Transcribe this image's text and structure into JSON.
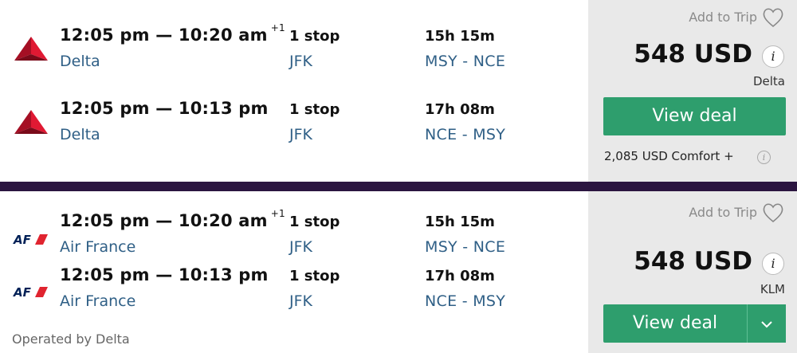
{
  "results": [
    {
      "legs": [
        {
          "airline": "Delta",
          "logo": "delta-logo",
          "departure": "12:05 pm",
          "arrival": "10:20 am",
          "day_offset": "+1",
          "stops": "1 stop",
          "via": "JFK",
          "duration": "15h 15m",
          "route": "MSY - NCE"
        },
        {
          "airline": "Delta",
          "logo": "delta-logo",
          "departure": "12:05 pm",
          "arrival": "10:13 pm",
          "day_offset": "",
          "stops": "1 stop",
          "via": "JFK",
          "duration": "17h 08m",
          "route": "NCE - MSY"
        }
      ],
      "add_to_trip": "Add to Trip",
      "price": "548 USD",
      "provider": "Delta",
      "view_deal": "View deal",
      "comfort_price": "2,085 USD Comfort +"
    },
    {
      "legs": [
        {
          "airline": "Air France",
          "logo": "air-france-logo",
          "departure": "12:05 pm",
          "arrival": "10:20 am",
          "day_offset": "+1",
          "stops": "1 stop",
          "via": "JFK",
          "duration": "15h 15m",
          "route": "MSY - NCE"
        },
        {
          "airline": "Air France",
          "logo": "air-france-logo",
          "departure": "12:05 pm",
          "arrival": "10:13 pm",
          "day_offset": "",
          "stops": "1 stop",
          "via": "JFK",
          "duration": "17h 08m",
          "route": "NCE - MSY"
        }
      ],
      "add_to_trip": "Add to Trip",
      "price": "548 USD",
      "provider": "KLM",
      "view_deal": "View deal",
      "operated_by": "Operated by Delta"
    }
  ],
  "time_separator": "—",
  "icons": {
    "heart": "heart-outline-icon",
    "info": "info-icon",
    "dropdown": "chevron-down-icon"
  },
  "colors": {
    "accent_green": "#2e9e6d",
    "airline_text": "#2f5f86",
    "divider": "#2b1540",
    "delta_red": "#c8102e",
    "air_france_navy": "#002157"
  }
}
